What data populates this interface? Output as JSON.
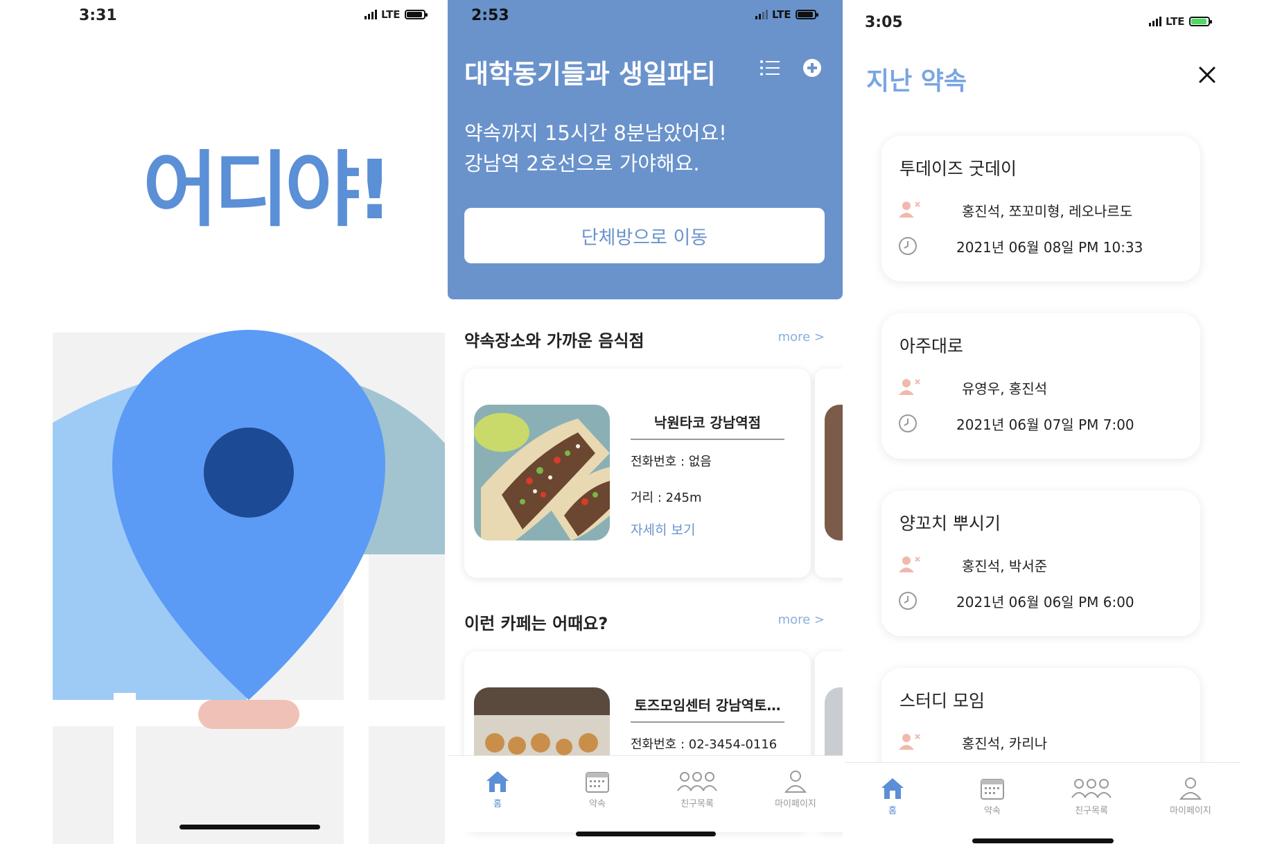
{
  "screen_splash": {
    "status_time": "3:31",
    "network": "LTE",
    "logo_text": "어디야!"
  },
  "screen_home": {
    "status_time": "2:53",
    "network": "LTE",
    "title": "대학동기들과 생일파티",
    "message_line1": "약속까지 15시간 8분남았어요!",
    "message_line2": "강남역 2호선으로 가야해요.",
    "move_button": "단체방으로 이동",
    "restaurants": {
      "title": "약속장소와 가까운 음식점",
      "more": "more >",
      "card": {
        "name": "낙원타코 강남역점",
        "phone": "전화번호 : 없음",
        "distance": "거리 : 245m",
        "detail": "자세히 보기"
      }
    },
    "cafes": {
      "title": "이런 카페는 어때요?",
      "more": "more >",
      "card": {
        "name": "토즈모임센터 강남역토…",
        "phone": "전화번호 : 02-3454-0116"
      }
    }
  },
  "screen_past": {
    "status_time": "3:05",
    "network": "LTE",
    "title": "지난 약속",
    "appointments": [
      {
        "name": "투데이즈 굿데이",
        "members": "홍진석, 쪼꼬미형, 레오나르도",
        "datetime": "2021년 06월 08일 PM 10:33"
      },
      {
        "name": "아주대로",
        "members": "유영우, 홍진석",
        "datetime": "2021년 06월 07일 PM 7:00"
      },
      {
        "name": "양꼬치 뿌시기",
        "members": "홍진석, 박서준",
        "datetime": "2021년 06월 06일 PM 6:00"
      },
      {
        "name": "스터디 모임",
        "members": "홍진석, 카리나"
      }
    ]
  },
  "tabbar": {
    "home": "홈",
    "appointment": "약속",
    "friends": "친구목록",
    "mypage": "마이페이지"
  },
  "colors": {
    "accent": "#6a93cc",
    "pin": "#5b9bf5",
    "pin_dark": "#1c4a94",
    "title_blue": "#7aa6e0"
  }
}
